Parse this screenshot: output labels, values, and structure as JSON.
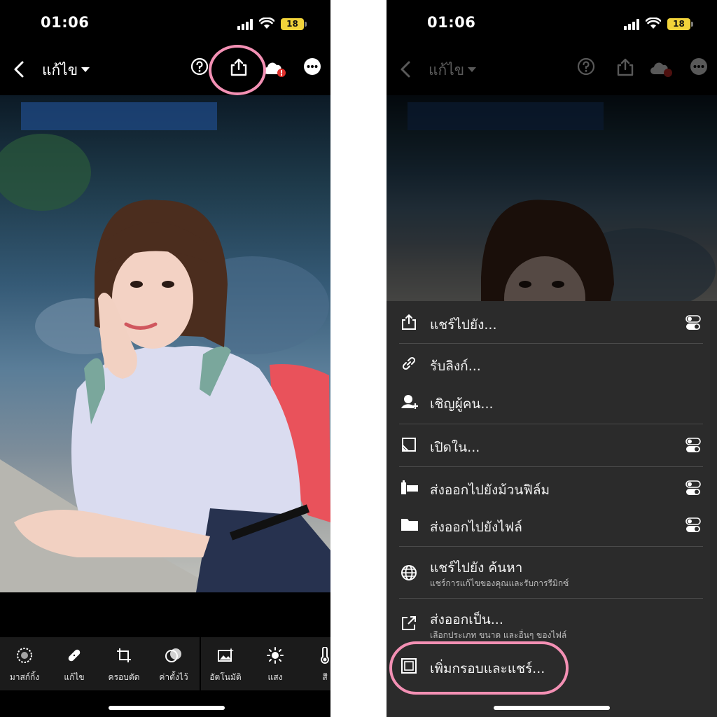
{
  "status_bar": {
    "time": "01:06",
    "battery": "18"
  },
  "editor": {
    "title": "แก้ไข",
    "tools": [
      {
        "icon": "masking-icon",
        "label": "มาสก์กิ้ง"
      },
      {
        "icon": "healing-icon",
        "label": "แก้ไข"
      },
      {
        "icon": "crop-icon",
        "label": "ครอบตัด"
      },
      {
        "icon": "presets-icon",
        "label": "ค่าตั้งไว้"
      },
      {
        "icon": "auto-icon",
        "label": "อัตโนมัติ"
      },
      {
        "icon": "light-icon",
        "label": "แสง"
      },
      {
        "icon": "color-icon",
        "label": "สี"
      }
    ]
  },
  "share_menu": {
    "items": [
      {
        "icon": "share-icon",
        "label": "แชร์ไปยัง..."
      },
      {
        "icon": "link-icon",
        "label": "รับลิงก์..."
      },
      {
        "icon": "invite-people-icon",
        "label": "เชิญผู้คน..."
      },
      {
        "icon": "open-in-icon",
        "label": "เปิดใน..."
      },
      {
        "icon": "camera-roll-icon",
        "label": "ส่งออกไปยังม้วนฟิล์ม"
      },
      {
        "icon": "folder-icon",
        "label": "ส่งออกไปยังไฟล์"
      },
      {
        "icon": "globe-icon",
        "label": "แชร์ไปยัง ค้นหา",
        "sub": "แชร์การแก้ไขของคุณและรับการรีมิกซ์"
      },
      {
        "icon": "export-as-icon",
        "label": "ส่งออกเป็น...",
        "sub": "เลือกประเภท ขนาด และอื่นๆ ของไฟล์"
      },
      {
        "icon": "frame-icon",
        "label": "เพิ่มกรอบและแชร์..."
      }
    ]
  },
  "colors": {
    "highlight": "#f390b4",
    "battery": "#f2d33a",
    "sheet": "#2b2b2b",
    "alert": "#e0302c"
  }
}
